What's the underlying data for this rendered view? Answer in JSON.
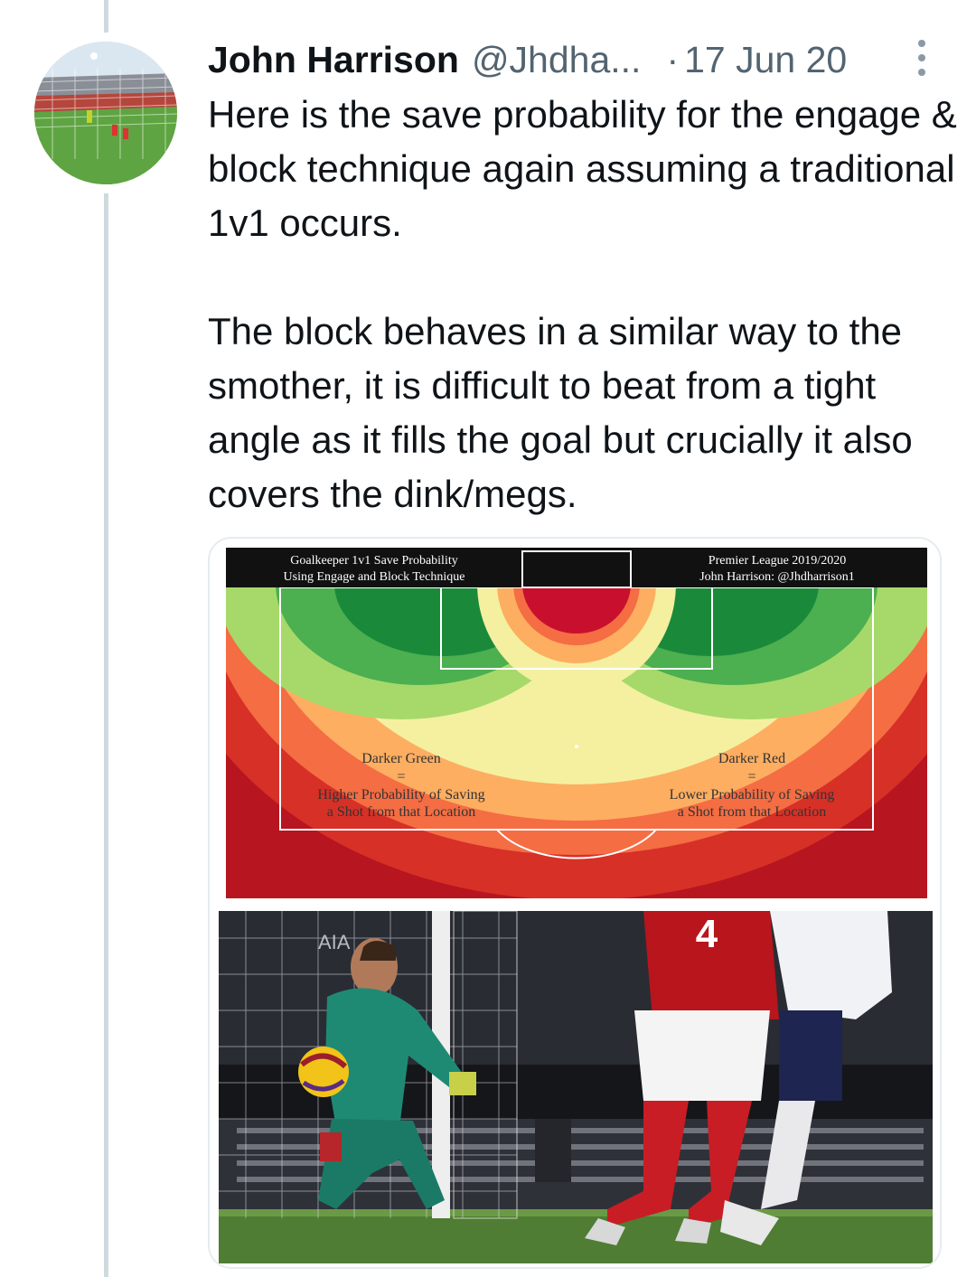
{
  "tweet": {
    "author_name": "John Harrison",
    "handle": "@Jhdha...",
    "separator": "·",
    "date": "17 Jun 20",
    "paragraphs": [
      "Here is the save probability for the engage & block technique again assuming a traditional 1v1 occurs.",
      "The block behaves in a similar way to the smother, it is difficult to beat from a tight angle as it fills the goal but crucially it also covers the dink/megs."
    ]
  },
  "heatmap_image": {
    "header_left_line1": "Goalkeeper 1v1 Save Probability",
    "header_left_line2": "Using Engage and Block Technique",
    "header_right_line1": "Premier League 2019/2020",
    "header_right_line2": "John Harrison: @Jhdharrison1",
    "legend_left_title": "Darker Green",
    "legend_left_eq": "=",
    "legend_left_line1": "Higher Probability of Saving",
    "legend_left_line2": "a Shot from that Location",
    "legend_right_title": "Darker Red",
    "legend_right_eq": "=",
    "legend_right_line1": "Lower Probability of Saving",
    "legend_right_line2": "a Shot from that Location",
    "colors": {
      "dark_green": "#1a8a3a",
      "green": "#4caf50",
      "light_green": "#a6d96a",
      "yellow": "#f4f0a0",
      "orange": "#fdae61",
      "red_orange": "#f46d43",
      "red": "#d73027",
      "dark_red": "#b7151f"
    }
  },
  "photo": {
    "shirt_number": "4",
    "sponsor_text": "AIA",
    "description_icon": "goalkeeper-save-photo"
  },
  "icons": {
    "more": "more-options-icon",
    "avatar": "avatar-image"
  }
}
